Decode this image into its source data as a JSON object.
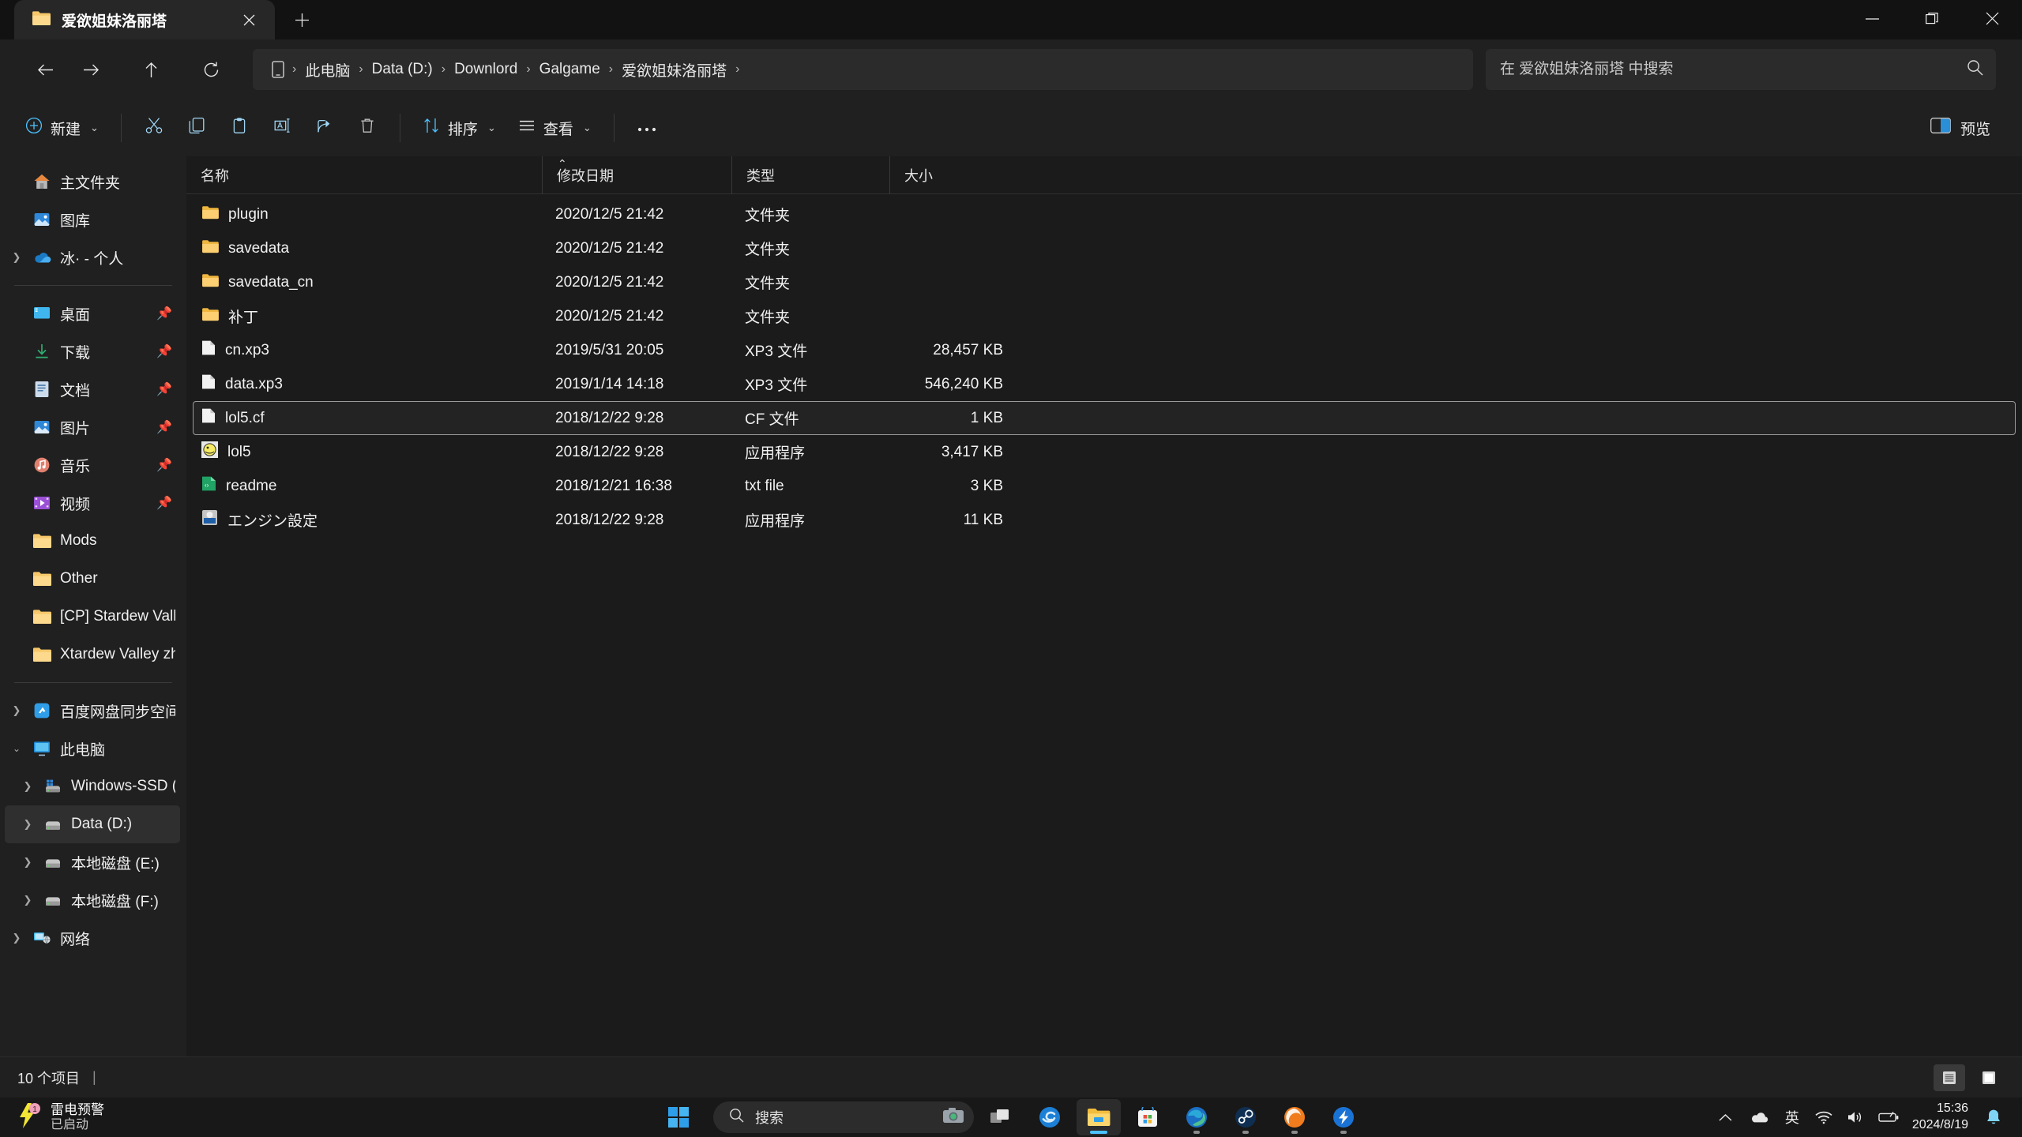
{
  "window": {
    "tab_title": "爱欲姐妹洛丽塔",
    "tab_icon": "folder-icon",
    "close_tab_icon": "close-icon",
    "new_tab_icon": "plus-icon",
    "minimize_icon": "minimize-icon",
    "restore_icon": "restore-icon",
    "close_icon": "close-icon"
  },
  "nav": {
    "back_icon": "arrow-left-icon",
    "forward_icon": "arrow-right-icon",
    "up_icon": "arrow-up-icon",
    "refresh_icon": "refresh-icon",
    "breadcrumb_root_icon": "this-pc-icon",
    "breadcrumbs": [
      "此电脑",
      "Data (D:)",
      "Downlord",
      "Galgame",
      "爱欲姐妹洛丽塔"
    ],
    "separator": "›"
  },
  "search": {
    "placeholder": "在 爱欲姐妹洛丽塔 中搜索",
    "value": "",
    "icon": "search-icon"
  },
  "toolbar": {
    "new_label": "新建",
    "new_icon": "plus-circle-icon",
    "cut_icon": "scissors-icon",
    "copy_icon": "copy-icon",
    "paste_icon": "clipboard-icon",
    "rename_icon": "rename-icon",
    "share_icon": "share-icon",
    "delete_icon": "trash-icon",
    "sort_label": "排序",
    "sort_icon": "sort-icon",
    "view_label": "查看",
    "view_icon": "list-icon",
    "more_label": "···",
    "more_icon": "ellipsis-icon",
    "preview_label": "预览",
    "preview_icon": "preview-pane-icon",
    "chevron": "⌄"
  },
  "sidebar": {
    "groups": [
      {
        "items": [
          {
            "label": "主文件夹",
            "icon": "home-icon",
            "expandable": false,
            "pinned": false,
            "selected": false,
            "indent": 0
          },
          {
            "label": "图库",
            "icon": "gallery-icon",
            "expandable": false,
            "pinned": false,
            "selected": false,
            "indent": 0
          },
          {
            "label": "冰· - 个人",
            "icon": "onedrive-icon",
            "expandable": true,
            "pinned": false,
            "selected": false,
            "indent": 0
          }
        ]
      },
      {
        "items": [
          {
            "label": "桌面",
            "icon": "desktop-icon",
            "expandable": false,
            "pinned": true,
            "selected": false,
            "indent": 0
          },
          {
            "label": "下载",
            "icon": "downloads-icon",
            "expandable": false,
            "pinned": true,
            "selected": false,
            "indent": 0
          },
          {
            "label": "文档",
            "icon": "documents-icon",
            "expandable": false,
            "pinned": true,
            "selected": false,
            "indent": 0
          },
          {
            "label": "图片",
            "icon": "pictures-icon",
            "expandable": false,
            "pinned": true,
            "selected": false,
            "indent": 0
          },
          {
            "label": "音乐",
            "icon": "music-icon",
            "expandable": false,
            "pinned": true,
            "selected": false,
            "indent": 0
          },
          {
            "label": "视频",
            "icon": "videos-icon",
            "expandable": false,
            "pinned": true,
            "selected": false,
            "indent": 0
          },
          {
            "label": "Mods",
            "icon": "folder-icon",
            "expandable": false,
            "pinned": false,
            "selected": false,
            "indent": 0
          },
          {
            "label": "Other",
            "icon": "folder-icon",
            "expandable": false,
            "pinned": false,
            "selected": false,
            "indent": 0
          },
          {
            "label": "[CP] Stardew Valley",
            "icon": "folder-icon",
            "expandable": false,
            "pinned": false,
            "selected": false,
            "indent": 0
          },
          {
            "label": "Xtardew Valley zh",
            "icon": "folder-icon",
            "expandable": false,
            "pinned": false,
            "selected": false,
            "indent": 0
          }
        ]
      },
      {
        "items": [
          {
            "label": "百度网盘同步空间",
            "icon": "baidu-netdisk-icon",
            "expandable": true,
            "pinned": false,
            "selected": false,
            "indent": 0
          },
          {
            "label": "此电脑",
            "icon": "this-pc-icon",
            "expandable": true,
            "expanded": true,
            "pinned": false,
            "selected": false,
            "indent": 0
          },
          {
            "label": "Windows-SSD (C:)",
            "icon": "windows-drive-icon",
            "expandable": true,
            "pinned": false,
            "selected": false,
            "indent": 1
          },
          {
            "label": "Data (D:)",
            "icon": "drive-icon",
            "expandable": true,
            "pinned": false,
            "selected": true,
            "indent": 1
          },
          {
            "label": "本地磁盘 (E:)",
            "icon": "drive-icon",
            "expandable": true,
            "pinned": false,
            "selected": false,
            "indent": 1
          },
          {
            "label": "本地磁盘 (F:)",
            "icon": "drive-icon",
            "expandable": true,
            "pinned": false,
            "selected": false,
            "indent": 1
          },
          {
            "label": "网络",
            "icon": "network-icon",
            "expandable": true,
            "pinned": false,
            "selected": false,
            "indent": 0
          }
        ]
      }
    ]
  },
  "filelist": {
    "columns": [
      {
        "label": "名称",
        "key": "name"
      },
      {
        "label": "修改日期",
        "key": "date"
      },
      {
        "label": "类型",
        "key": "type"
      },
      {
        "label": "大小",
        "key": "size"
      }
    ],
    "sort_column": "名称",
    "sort_direction": "ascending",
    "sort_glyph": "⌃",
    "rows": [
      {
        "name": "plugin",
        "date": "2020/12/5 21:42",
        "type": "文件夹",
        "size": "",
        "icon": "folder-icon",
        "focused": false
      },
      {
        "name": "savedata",
        "date": "2020/12/5 21:42",
        "type": "文件夹",
        "size": "",
        "icon": "folder-icon",
        "focused": false
      },
      {
        "name": "savedata_cn",
        "date": "2020/12/5 21:42",
        "type": "文件夹",
        "size": "",
        "icon": "folder-icon",
        "focused": false
      },
      {
        "name": "补丁",
        "date": "2020/12/5 21:42",
        "type": "文件夹",
        "size": "",
        "icon": "folder-icon",
        "focused": false
      },
      {
        "name": "cn.xp3",
        "date": "2019/5/31 20:05",
        "type": "XP3 文件",
        "size": "28,457 KB",
        "icon": "file-icon",
        "focused": false
      },
      {
        "name": "data.xp3",
        "date": "2019/1/14 14:18",
        "type": "XP3 文件",
        "size": "546,240 KB",
        "icon": "file-icon",
        "focused": false
      },
      {
        "name": "lol5.cf",
        "date": "2018/12/22 9:28",
        "type": "CF 文件",
        "size": "1 KB",
        "icon": "file-icon",
        "focused": true
      },
      {
        "name": "lol5",
        "date": "2018/12/22 9:28",
        "type": "应用程序",
        "size": "3,417 KB",
        "icon": "app-lol5-icon",
        "focused": false
      },
      {
        "name": "readme",
        "date": "2018/12/21 16:38",
        "type": "txt file",
        "size": "3 KB",
        "icon": "text-icon",
        "focused": false
      },
      {
        "name": "エンジン設定",
        "date": "2018/12/22 9:28",
        "type": "应用程序",
        "size": "11 KB",
        "icon": "app-config-icon",
        "focused": false
      }
    ]
  },
  "statusbar": {
    "item_count": "10 个项目",
    "separator": "|",
    "details_view_icon": "details-view-icon",
    "large_icons_view_icon": "large-icons-view-icon"
  },
  "taskbar": {
    "weather": {
      "title": "雷电预警",
      "subtitle": "已启动",
      "icon": "lightning-icon",
      "badge": "1"
    },
    "start_icon": "windows-start-icon",
    "search": {
      "label": "搜索",
      "icon": "search-icon",
      "camera_icon": "camera-icon"
    },
    "apps": [
      {
        "name": "task-view",
        "icon": "task-view-icon",
        "active": false,
        "running": false
      },
      {
        "name": "browser-e",
        "icon": "e-browser-icon",
        "active": false,
        "running": false
      },
      {
        "name": "file-explorer",
        "icon": "file-explorer-icon",
        "active": true,
        "running": true
      },
      {
        "name": "microsoft-store",
        "icon": "microsoft-store-icon",
        "active": false,
        "running": false
      },
      {
        "name": "microsoft-edge",
        "icon": "edge-icon",
        "active": false,
        "running": true
      },
      {
        "name": "steam",
        "icon": "steam-icon",
        "active": false,
        "running": true
      },
      {
        "name": "orange-browser",
        "icon": "orange-browser-icon",
        "active": false,
        "running": true
      },
      {
        "name": "thunder",
        "icon": "thunder-icon",
        "active": false,
        "running": true
      }
    ],
    "tray": {
      "overflow_icon": "chevron-up-icon",
      "onedrive_icon": "onedrive-cloud-icon",
      "ime_label": "英",
      "wifi_icon": "wifi-icon",
      "volume_icon": "volume-icon",
      "battery_icon": "battery-icon",
      "time": "15:36",
      "date": "2024/8/19",
      "notification_icon": "bell-icon"
    }
  },
  "colors": {
    "accent": "#4cc2ff",
    "folder": "#f6c76a",
    "window_bg": "#202020",
    "content_bg": "#1b1b1b",
    "titlebar_bg": "#121212",
    "taskbar_bg": "#181818"
  }
}
